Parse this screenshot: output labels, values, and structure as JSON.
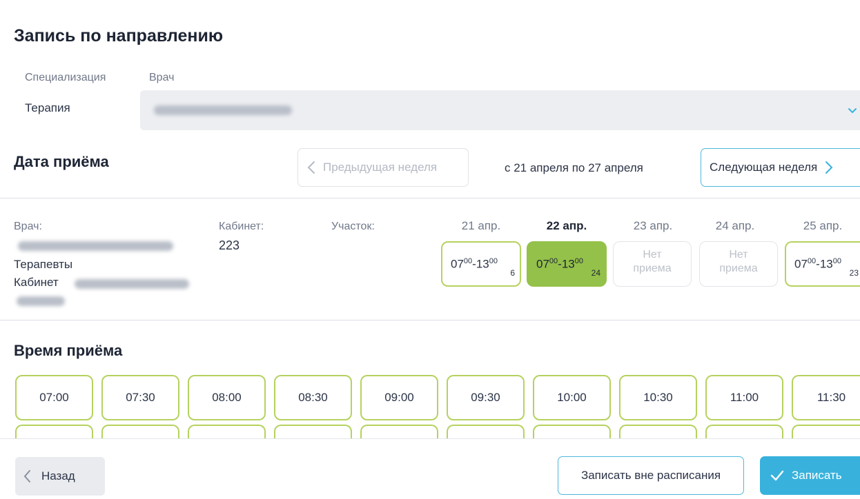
{
  "page": {
    "title": "Запись по направлению"
  },
  "form": {
    "spec_label": "Специализация",
    "doctor_label": "Врач",
    "spec_value": "Терапия"
  },
  "week": {
    "heading": "Дата приёма",
    "prev_label": "Предыдущая неделя",
    "range": "с 21 апреля по 27 апреля",
    "next_label": "Следующая неделя"
  },
  "doctor_info": {
    "doctor_label": "Врач:",
    "specialty": "Терапевты",
    "cabinet_prefix": "Кабинет",
    "cabinet_label": "Кабинет:",
    "cabinet_value": "223",
    "area_label": "Участок:"
  },
  "days": [
    {
      "date": "21 апр.",
      "start_h": "07",
      "start_m": "00",
      "end_h": "13",
      "end_m": "00",
      "count": "6",
      "state": "available"
    },
    {
      "date": "22 апр.",
      "start_h": "07",
      "start_m": "00",
      "end_h": "13",
      "end_m": "00",
      "count": "24",
      "state": "selected"
    },
    {
      "date": "23 апр.",
      "no_line1": "Нет",
      "no_line2": "приема",
      "state": "none"
    },
    {
      "date": "24 апр.",
      "no_line1": "Нет",
      "no_line2": "приема",
      "state": "none"
    },
    {
      "date": "25 апр.",
      "start_h": "07",
      "start_m": "00",
      "end_h": "13",
      "end_m": "00",
      "count": "23",
      "state": "available"
    }
  ],
  "times": {
    "heading": "Время приёма",
    "slots": [
      "07:00",
      "07:30",
      "08:00",
      "08:30",
      "09:00",
      "09:30",
      "10:00",
      "10:30",
      "11:00",
      "11:30"
    ]
  },
  "footer": {
    "back_label": "Назад",
    "outside_label": "Записать вне расписания",
    "book_label": "Записать"
  },
  "colors": {
    "accent": "#38b2dc",
    "slot_border": "#b5d25f",
    "slot_selected": "#94c14a"
  }
}
